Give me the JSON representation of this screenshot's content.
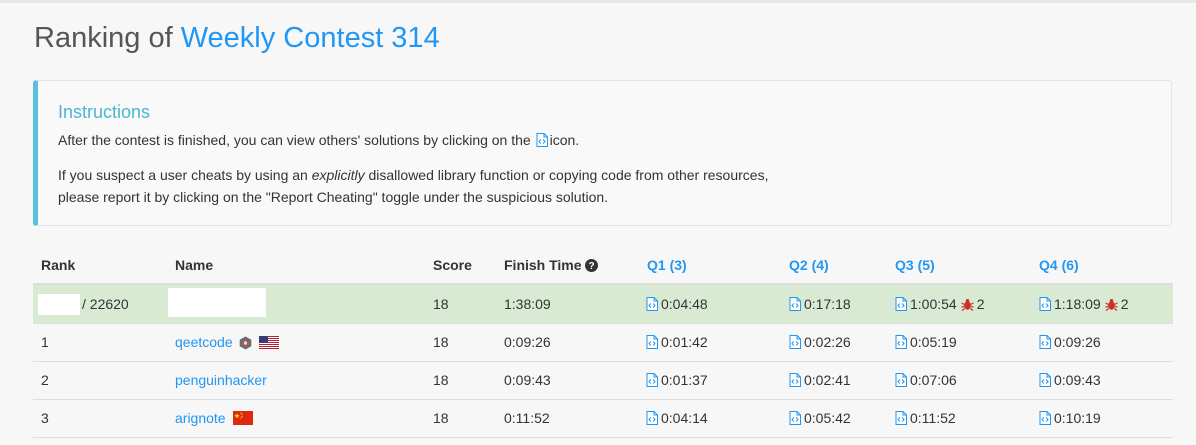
{
  "page": {
    "title_prefix": "Ranking of ",
    "title_contest": "Weekly Contest 314"
  },
  "instructions": {
    "heading": "Instructions",
    "p1_before": "After the contest is finished, you can view others' solutions by clicking on the",
    "p1_after": "icon.",
    "p2_a": "If you suspect a user cheats by using an ",
    "p2_em": "explicitly",
    "p2_b": " disallowed library function or copying code from other resources,",
    "p3": "please report it by clicking on the \"Report Cheating\" toggle under the suspicious solution."
  },
  "table": {
    "headers": {
      "rank": "Rank",
      "name": "Name",
      "score": "Score",
      "finish": "Finish Time",
      "q1": "Q1 (3)",
      "q2": "Q2 (4)",
      "q3": "Q3 (5)",
      "q4": "Q4 (6)"
    },
    "me": {
      "rank_suffix": "/ 22620",
      "score": "18",
      "finish": "1:38:09",
      "q1": "0:04:48",
      "q2": "0:17:18",
      "q3": "1:00:54",
      "q3_bugs": "2",
      "q4": "1:18:09",
      "q4_bugs": "2"
    },
    "rows": [
      {
        "rank": "1",
        "name": "qeetcode",
        "score": "18",
        "finish": "0:09:26",
        "q1": "0:01:42",
        "q2": "0:02:26",
        "q3": "0:05:19",
        "q4": "0:09:26",
        "flag": "us-flag"
      },
      {
        "rank": "2",
        "name": "penguinhacker",
        "score": "18",
        "finish": "0:09:43",
        "q1": "0:01:37",
        "q2": "0:02:41",
        "q3": "0:07:06",
        "q4": "0:09:43",
        "flag": ""
      },
      {
        "rank": "3",
        "name": "arignote",
        "score": "18",
        "finish": "0:11:52",
        "q1": "0:04:14",
        "q2": "0:05:42",
        "q3": "0:11:52",
        "q4": "0:10:19",
        "flag": "cn-flag"
      }
    ]
  },
  "colors": {
    "accent": "#2196f3",
    "info": "#5bc0de",
    "my_row": "#d9ead3",
    "bug": "#c9302c"
  }
}
